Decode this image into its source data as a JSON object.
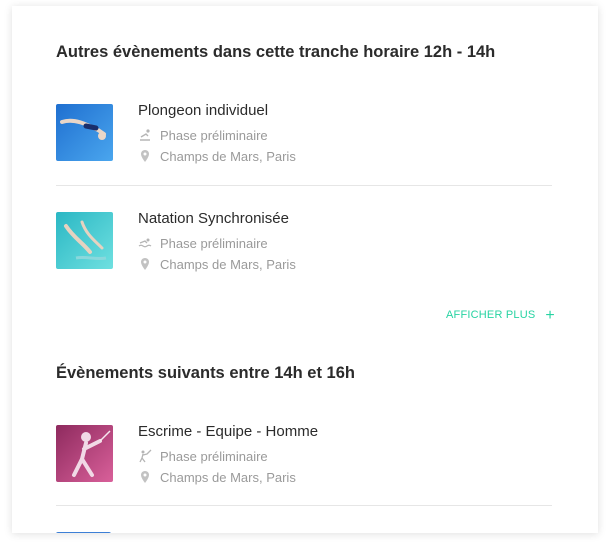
{
  "sections": [
    {
      "title": "Autres évènements dans cette tranche horaire 12h - 14h"
    },
    {
      "title": "Évènements suivants entre 14h et 16h"
    }
  ],
  "events": [
    {
      "title": "Plongeon individuel",
      "phase": "Phase préliminaire",
      "location": "Champs de Mars, Paris",
      "sport_icon": "diving-icon",
      "thumb_color": "#2f86d9"
    },
    {
      "title": "Natation Synchronisée",
      "phase": "Phase préliminaire",
      "location": "Champs de Mars, Paris",
      "sport_icon": "swimming-icon",
      "thumb_color": "#3fc6cf"
    },
    {
      "title": "Escrime - Equipe - Homme",
      "phase": "Phase préliminaire",
      "location": "Champs de Mars, Paris",
      "sport_icon": "fencing-icon",
      "thumb_color": "#b8407e"
    }
  ],
  "show_more": {
    "label": "AFFICHER PLUS",
    "icon": "plus-icon"
  },
  "colors": {
    "accent": "#27d3a2",
    "meta_text": "#9a9a9a",
    "title_text": "#2b2b2b"
  }
}
